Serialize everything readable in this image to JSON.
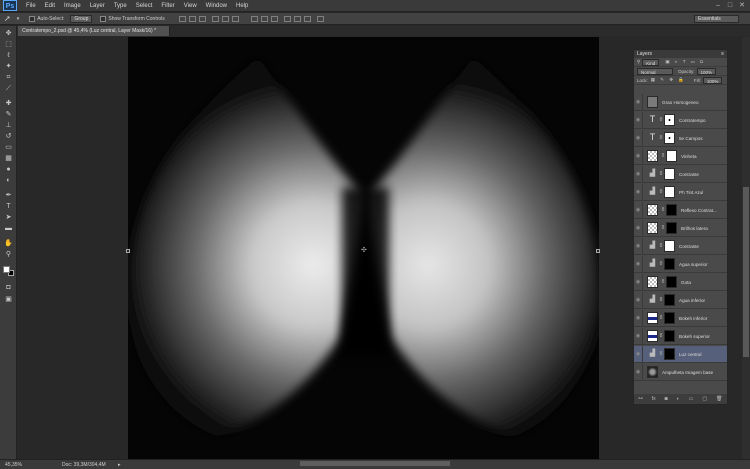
{
  "menu": {
    "logo": "Ps",
    "items": [
      "File",
      "Edit",
      "Image",
      "Layer",
      "Type",
      "Select",
      "Filter",
      "View",
      "Window",
      "Help"
    ]
  },
  "options": {
    "auto_select": "Auto-Select:",
    "group": "Group",
    "show_transform": "Show Transform Controls",
    "workspace": "Essentials"
  },
  "document": {
    "tab_title": "Contratempo_2.psd @ 45,4% (Luz central, Layer Mask/16) *",
    "zoom": "45,35%",
    "doc_info": "Doc: 39,3M/304,4M"
  },
  "layers_panel": {
    "title": "Layers",
    "kind": "Kind",
    "blend_mode": "Normal",
    "opacity_label": "Opacity:",
    "opacity_value": "100%",
    "lock_label": "Lock:",
    "fill_label": "Fill:",
    "fill_value": "100%",
    "layers": [
      {
        "name": "Grao Homogeneo",
        "thumb": "gray",
        "mask": "none",
        "selected": false
      },
      {
        "name": "Contratempo",
        "thumb": "text",
        "mask": "white-dot",
        "selected": false
      },
      {
        "name": "5e Campos",
        "thumb": "text",
        "mask": "white-dot",
        "selected": false
      },
      {
        "name": "Vinheta",
        "thumb": "checker",
        "mask": "white",
        "selected": false
      },
      {
        "name": "Contraste",
        "thumb": "adjust",
        "mask": "white",
        "selected": false
      },
      {
        "name": "Ph Tint Azul",
        "thumb": "adjust",
        "mask": "white",
        "selected": false
      },
      {
        "name": "Reflexo Contrat...",
        "thumb": "checker",
        "mask": "black",
        "selected": false
      },
      {
        "name": "Brilhos latera",
        "thumb": "checker",
        "mask": "black",
        "selected": false
      },
      {
        "name": "Contraste",
        "thumb": "adjust",
        "mask": "white",
        "selected": false
      },
      {
        "name": "Agua superior",
        "thumb": "adjust",
        "mask": "black",
        "selected": false
      },
      {
        "name": "Gota",
        "thumb": "checker",
        "mask": "black",
        "selected": false
      },
      {
        "name": "Agua inferior",
        "thumb": "adjust",
        "mask": "black",
        "selected": false
      },
      {
        "name": "Bokeh inferior",
        "thumb": "blue",
        "mask": "black",
        "selected": false
      },
      {
        "name": "Bokeh superior",
        "thumb": "blue",
        "mask": "black",
        "selected": false
      },
      {
        "name": "Luz central",
        "thumb": "adjust",
        "mask": "black",
        "selected": true
      },
      {
        "name": "Ampulheta Imagem base",
        "thumb": "photo",
        "mask": "none",
        "selected": false
      }
    ]
  },
  "colors": {
    "accent_selected": "#56607a",
    "ps_blue": "#5aa9ff"
  }
}
